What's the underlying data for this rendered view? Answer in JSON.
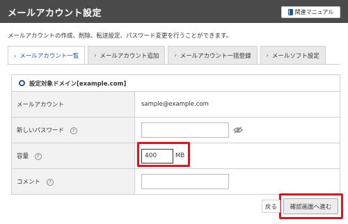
{
  "header": {
    "title": "メールアカウント設定",
    "manual_label": "関連マニュアル",
    "manual_icon": "book-icon"
  },
  "description": "メールアカウントの作成、削除、転送設定、パスワード変更を行うことができます。",
  "tabs": [
    {
      "label": "メールアカウント一覧",
      "active": true
    },
    {
      "label": "メールアカウント追加",
      "active": false
    },
    {
      "label": "メールアカウント一括登録",
      "active": false
    },
    {
      "label": "メールソフト設定",
      "active": false
    }
  ],
  "domain": {
    "label": "設定対象ドメイン[example.com]",
    "icon": "radio-ring-icon"
  },
  "form": {
    "account_label": "メールアカウント",
    "account_value": "sample@example.com",
    "password_label": "新しいパスワード",
    "password_value": "",
    "quota_label": "容量",
    "quota_value": "400",
    "quota_unit": "MB",
    "comment_label": "コメント",
    "comment_value": "",
    "help_glyph": "?"
  },
  "buttons": {
    "back_label": "戻る",
    "confirm_label": "確認画面へ進む"
  },
  "colors": {
    "header_bg": "#4b4b4b",
    "accent_blue": "#1a56a8",
    "highlight_red": "#e0141e",
    "label_bg": "#f2f2f2"
  }
}
